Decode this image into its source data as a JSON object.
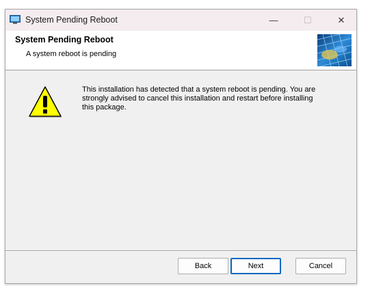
{
  "window": {
    "title": "System Pending Reboot",
    "minimize_glyph": "—",
    "maximize_glyph": "☐",
    "close_glyph": "✕",
    "icon": "installer-icon"
  },
  "header": {
    "title": "System Pending Reboot",
    "subtitle": "A system reboot is pending",
    "banner_icon": "installer-banner-icon"
  },
  "body": {
    "icon": "warning-icon",
    "message": "This installation has detected that a system reboot is pending.  You are strongly advised to cancel this installation and restart before installing this package."
  },
  "footer": {
    "back_label": "Back",
    "next_label": "Next",
    "cancel_label": "Cancel"
  },
  "colors": {
    "titlebar": "#f5ecf0",
    "dialog_bg": "#f0f0f0",
    "warning_yellow": "#ffff00",
    "default_button_border": "#0067c0"
  }
}
